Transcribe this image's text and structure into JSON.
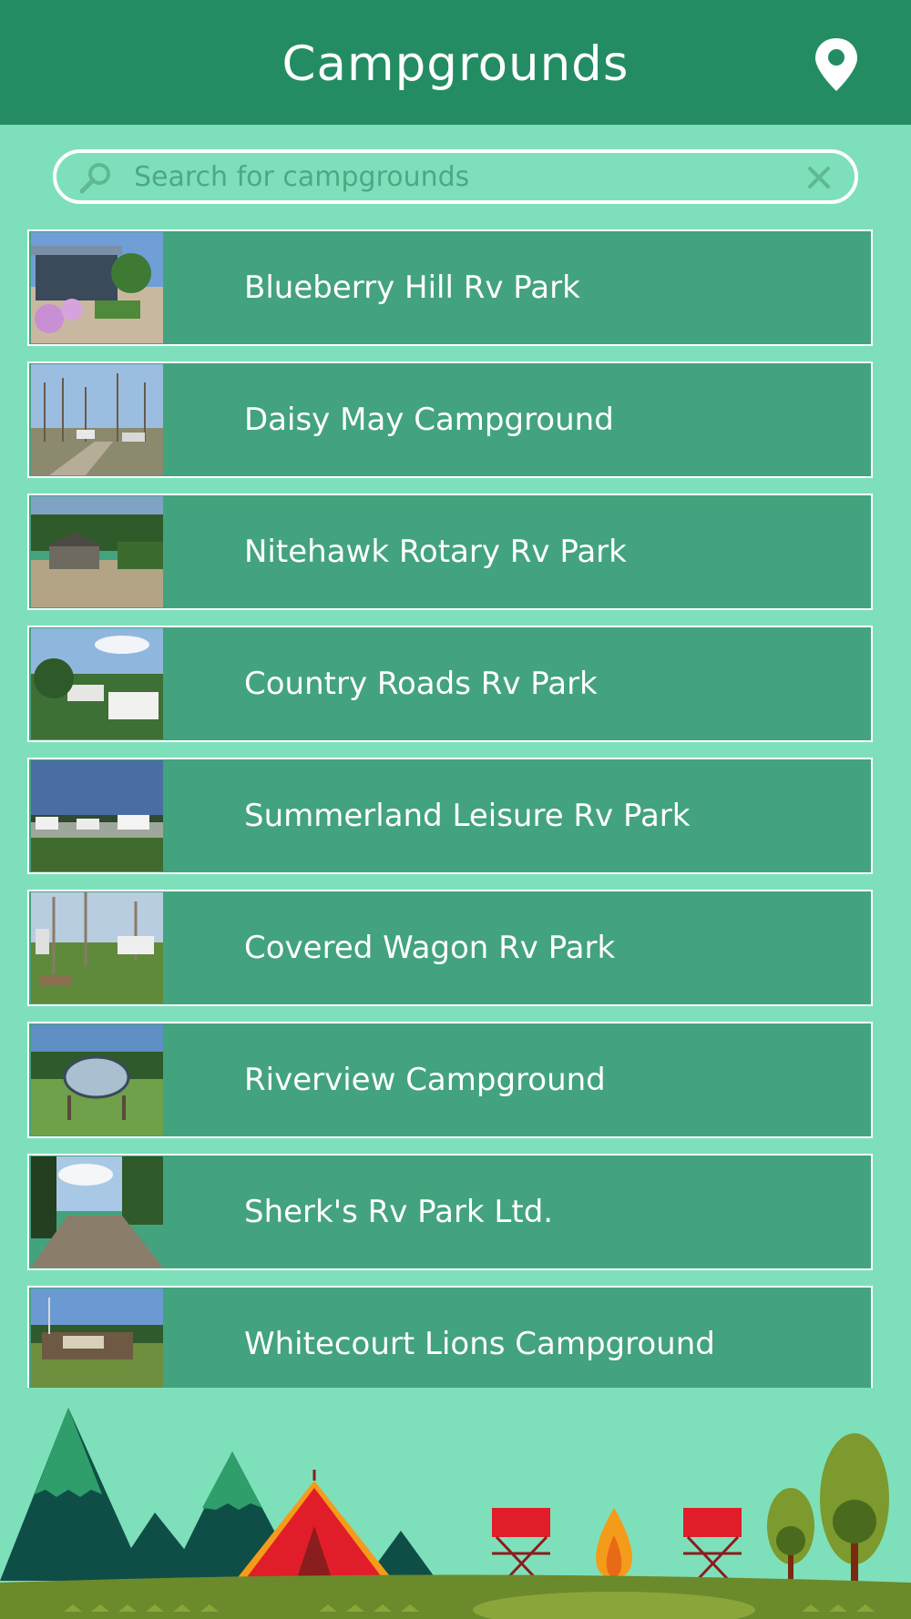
{
  "header": {
    "title": "Campgrounds",
    "location_icon": "map-pin-icon"
  },
  "search": {
    "placeholder": "Search for campgrounds",
    "search_icon": "magnifier-icon",
    "clear_icon": "close-icon"
  },
  "campgrounds": [
    {
      "name": "Blueberry Hill Rv Park"
    },
    {
      "name": "Daisy May Campground"
    },
    {
      "name": "Nitehawk Rotary Rv Park"
    },
    {
      "name": "Country Roads Rv Park"
    },
    {
      "name": "Summerland Leisure Rv Park"
    },
    {
      "name": "Covered Wagon Rv Park"
    },
    {
      "name": "Riverview Campground"
    },
    {
      "name": "Sherk's Rv Park Ltd."
    },
    {
      "name": "Whitecourt Lions Campground"
    }
  ],
  "colors": {
    "header": "#238c63",
    "background": "#7ee0bb",
    "row": "#43a37e",
    "row_border": "#ffffff"
  }
}
